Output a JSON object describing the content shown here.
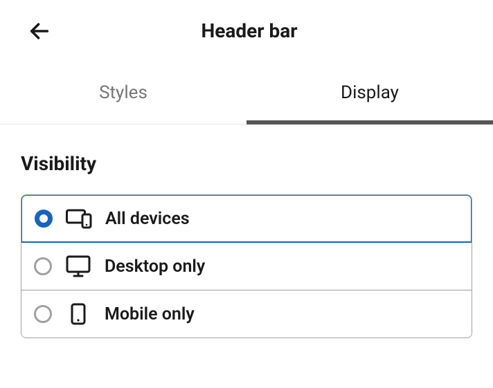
{
  "header": {
    "title": "Header bar"
  },
  "tabs": {
    "styles": "Styles",
    "display": "Display",
    "active": "display"
  },
  "section": {
    "title": "Visibility"
  },
  "options": {
    "all": "All devices",
    "desktop": "Desktop only",
    "mobile": "Mobile only",
    "selected": "all"
  }
}
